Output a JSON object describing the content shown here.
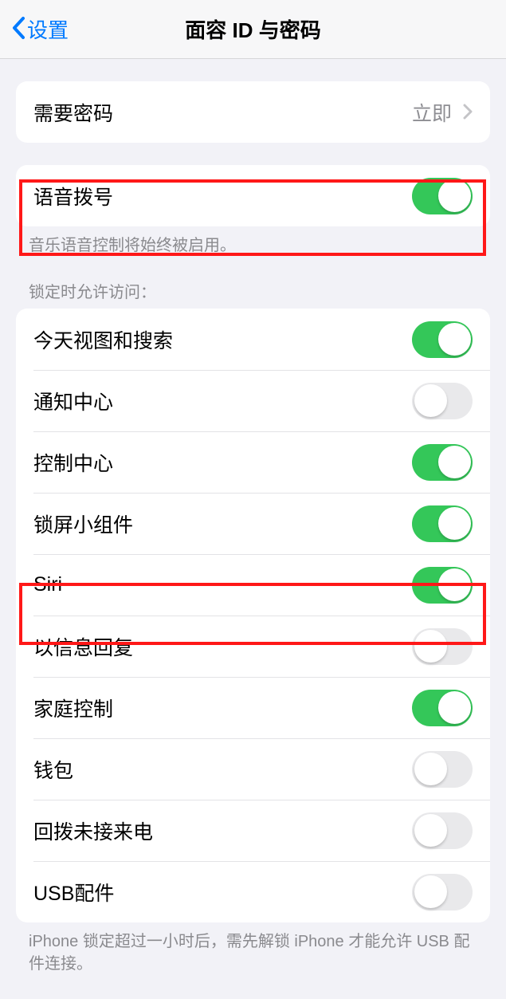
{
  "nav": {
    "back": "设置",
    "title": "面容 ID 与密码"
  },
  "passcode": {
    "label": "需要密码",
    "value": "立即"
  },
  "voice_dial": {
    "label": "语音拨号",
    "on": true,
    "footer": "音乐语音控制将始终被启用。"
  },
  "lock_access": {
    "header": "锁定时允许访问：",
    "items": [
      {
        "label": "今天视图和搜索",
        "on": true
      },
      {
        "label": "通知中心",
        "on": false
      },
      {
        "label": "控制中心",
        "on": true
      },
      {
        "label": "锁屏小组件",
        "on": true
      },
      {
        "label": "Siri",
        "on": true
      },
      {
        "label": "以信息回复",
        "on": false
      },
      {
        "label": "家庭控制",
        "on": true
      },
      {
        "label": "钱包",
        "on": false
      },
      {
        "label": "回拨未接来电",
        "on": false
      },
      {
        "label": "USB配件",
        "on": false
      }
    ],
    "footer": "iPhone 锁定超过一小时后，需先解锁 iPhone 才能允许 USB 配件连接。"
  }
}
